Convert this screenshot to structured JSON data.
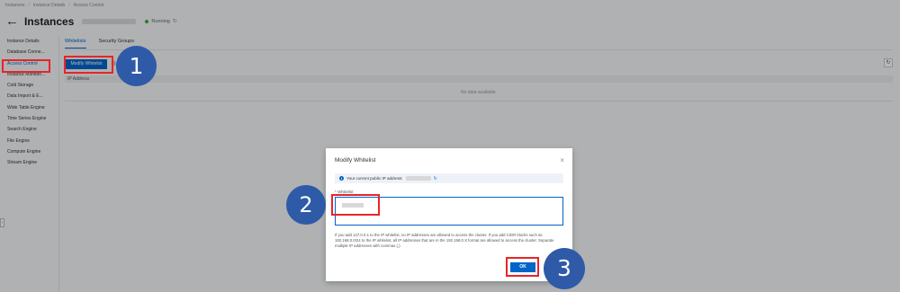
{
  "breadcrumb": [
    "Instances",
    "Instance Details",
    "Access Control"
  ],
  "header": {
    "title": "Instances",
    "status": "Running"
  },
  "sidebar": {
    "items": [
      {
        "label": "Instance Details",
        "active": false
      },
      {
        "label": "Database Conne...",
        "active": false
      },
      {
        "label": "Access Control",
        "active": true
      },
      {
        "label": "Instance Monitori...",
        "active": false
      },
      {
        "label": "Cold Storage",
        "active": false
      },
      {
        "label": "Data Import & E...",
        "active": false
      },
      {
        "label": "Wide Table Engine",
        "active": false
      },
      {
        "label": "Time Series Engine",
        "active": false
      },
      {
        "label": "Search Engine",
        "active": false
      },
      {
        "label": "File Engine",
        "active": false
      },
      {
        "label": "Compute Engine",
        "active": false
      },
      {
        "label": "Stream Engine",
        "active": false
      }
    ]
  },
  "tabs": [
    {
      "label": "Whitelists",
      "active": true
    },
    {
      "label": "Security Groups",
      "active": false
    }
  ],
  "toolbar": {
    "modify_label": "Modify Whitelist"
  },
  "table": {
    "columns": [
      "IP Address"
    ],
    "empty_text": "No data available."
  },
  "dialog": {
    "title": "Modify Whitelist",
    "ip_notice": "Your current public IP address:",
    "field_label": "Whitelist",
    "help": "If you add 127.0.0.1 to the IP whitelist, no IP addresses are allowed to access the cluster. If you add CIDR blocks such as 192.168.0.0/24 to the IP whitelist, all IP addresses that are in the 192.168.0.X format are allowed to access the cluster. Separate multiple IP addresses with commas (,).",
    "ok_label": "OK"
  },
  "annotations": [
    "1",
    "2",
    "3"
  ],
  "colors": {
    "accent": "#0064c8",
    "callout": "#e8242a",
    "step_circle": "#2e5aa8"
  }
}
